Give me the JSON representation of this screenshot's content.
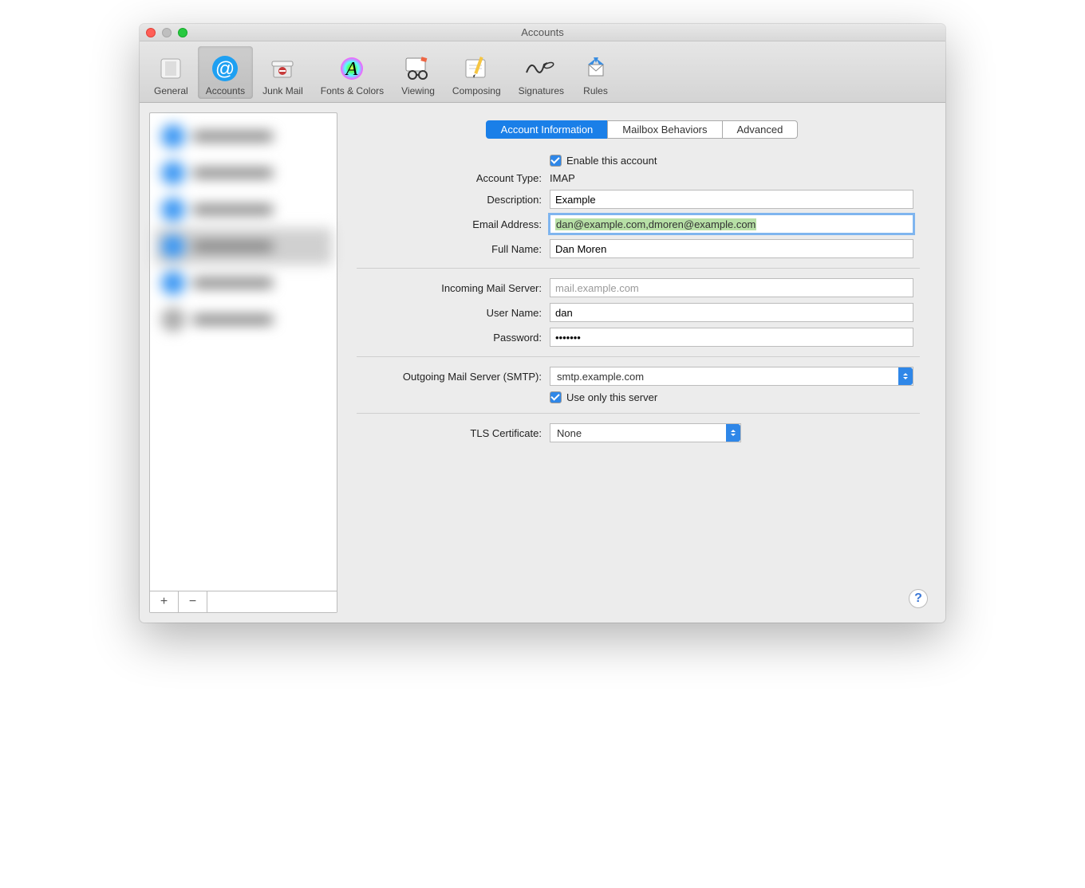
{
  "window": {
    "title": "Accounts"
  },
  "toolbar": {
    "general": "General",
    "accounts": "Accounts",
    "junk": "Junk Mail",
    "fonts": "Fonts & Colors",
    "viewing": "Viewing",
    "composing": "Composing",
    "signatures": "Signatures",
    "rules": "Rules"
  },
  "tabs": {
    "info": "Account Information",
    "mailbox": "Mailbox Behaviors",
    "advanced": "Advanced"
  },
  "labels": {
    "enable": "Enable this account",
    "account_type": "Account Type:",
    "description": "Description:",
    "email": "Email Address:",
    "full_name": "Full Name:",
    "incoming": "Incoming Mail Server:",
    "username": "User Name:",
    "password": "Password:",
    "outgoing": "Outgoing Mail Server (SMTP):",
    "use_only": "Use only this server",
    "tls": "TLS Certificate:"
  },
  "values": {
    "account_type": "IMAP",
    "description": "Example",
    "email": "dan@example.com,dmoren@example.com",
    "full_name": "Dan Moren",
    "incoming": "mail.example.com",
    "username": "dan",
    "password": "•••••••",
    "smtp": "smtp.example.com",
    "tls": "None"
  },
  "buttons": {
    "add": "+",
    "remove": "−",
    "help": "?"
  }
}
